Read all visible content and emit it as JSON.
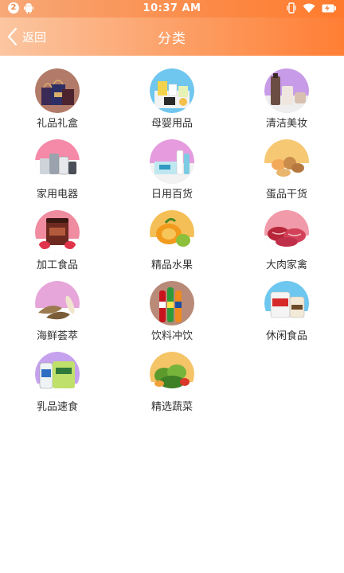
{
  "status_bar": {
    "notification_count": "2",
    "time": "10:37 AM"
  },
  "nav": {
    "back_label": "返回",
    "title": "分类"
  },
  "categories": [
    {
      "label": "礼品礼盒",
      "icon": "gift-box-icon",
      "bg": "#b27a68"
    },
    {
      "label": "母婴用品",
      "icon": "baby-products-icon",
      "bg": "#6fc6ef"
    },
    {
      "label": "清洁美妆",
      "icon": "cosmetics-icon",
      "bg": "#c79be8"
    },
    {
      "label": "家用电器",
      "icon": "home-appliance-icon",
      "bg": "#f58aa8"
    },
    {
      "label": "日用百货",
      "icon": "daily-goods-icon",
      "bg": "#e59bde"
    },
    {
      "label": "蛋品干货",
      "icon": "eggs-dried-goods-icon",
      "bg": "#f6c873"
    },
    {
      "label": "加工食品",
      "icon": "processed-food-icon",
      "bg": "#f08ca0"
    },
    {
      "label": "精品水果",
      "icon": "fruit-icon",
      "bg": "#f5bf58"
    },
    {
      "label": "大肉家禽",
      "icon": "meat-poultry-icon",
      "bg": "#f19aa9"
    },
    {
      "label": "海鲜荟萃",
      "icon": "seafood-icon",
      "bg": "#e7a6da"
    },
    {
      "label": "饮料冲饮",
      "icon": "beverage-icon",
      "bg": "#b88a77"
    },
    {
      "label": "休闲食品",
      "icon": "snack-icon",
      "bg": "#6ec7ef"
    },
    {
      "label": "乳品速食",
      "icon": "dairy-instant-food-icon",
      "bg": "#c5a1ee"
    },
    {
      "label": "精选蔬菜",
      "icon": "vegetable-icon",
      "bg": "#f5c466"
    }
  ]
}
